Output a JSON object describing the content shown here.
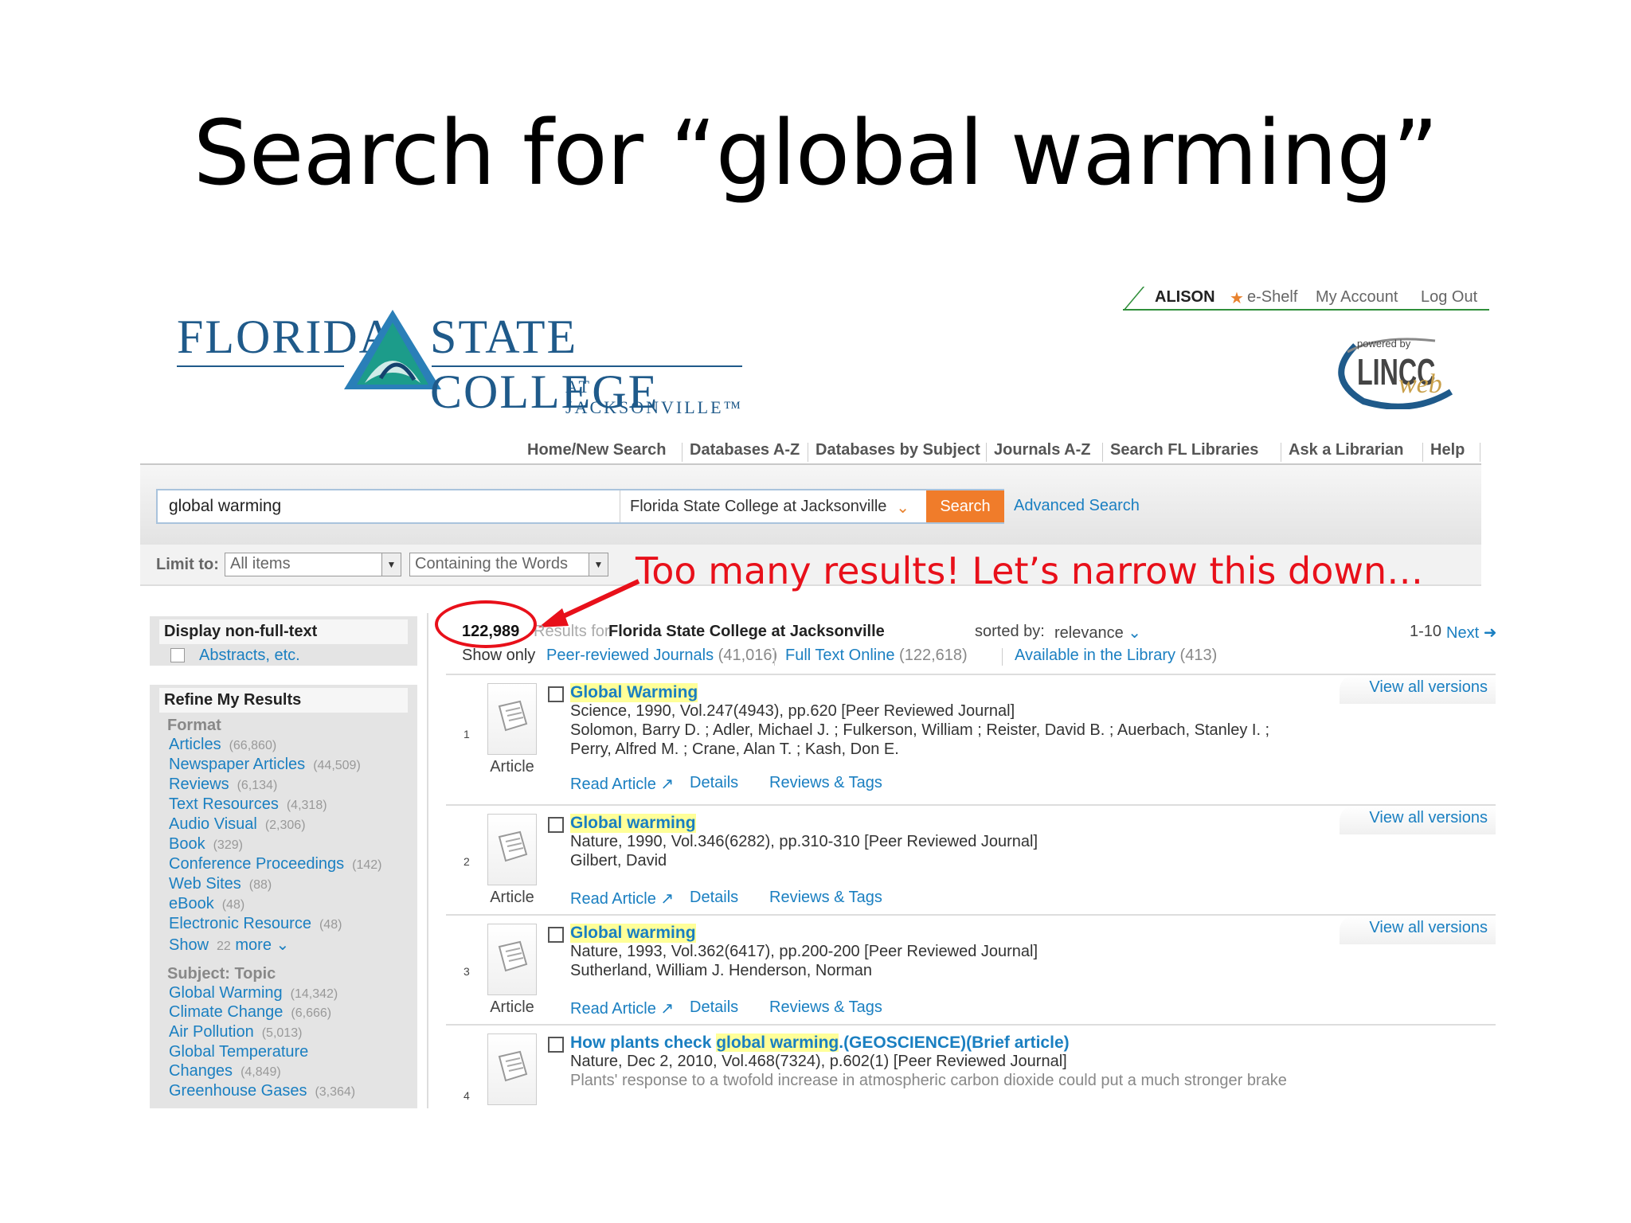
{
  "slide": {
    "title": "Search for “global warming”"
  },
  "annotation": "Too many results!  Let’s narrow this down…",
  "logo": {
    "word1": "FLORIDA",
    "word2": "STATE COLLEGE",
    "sub": "AT JACKSONVILLE™"
  },
  "userbar": {
    "user": "ALISON",
    "eshelf": "e-Shelf",
    "account": "My Account",
    "logout": "Log Out"
  },
  "lincc": {
    "powered": "powered by",
    "brand": "LINCC",
    "web": "web"
  },
  "nav": [
    "Home/New Search",
    "Databases A-Z",
    "Databases by Subject",
    "Journals A-Z",
    "Search FL Libraries",
    "Ask a Librarian",
    "Help"
  ],
  "search": {
    "query": "global warming",
    "scope": "Florida State College at Jacksonville",
    "button": "Search",
    "advanced": "Advanced Search"
  },
  "limit": {
    "label": "Limit to:",
    "items": "All items",
    "words": "Containing the Words"
  },
  "sidebar": {
    "display_head": "Display non-full-text",
    "display_opt": "Abstracts, etc.",
    "refine_head": "Refine My Results",
    "format_head": "Format",
    "formats": [
      {
        "label": "Articles",
        "count": "(66,860)"
      },
      {
        "label": "Newspaper Articles",
        "count": "(44,509)"
      },
      {
        "label": "Reviews",
        "count": "(6,134)"
      },
      {
        "label": "Text Resources",
        "count": "(4,318)"
      },
      {
        "label": "Audio Visual",
        "count": "(2,306)"
      },
      {
        "label": "Book",
        "count": "(329)"
      },
      {
        "label": "Conference Proceedings",
        "count": "(142)"
      },
      {
        "label": "Web Sites",
        "count": "(88)"
      },
      {
        "label": "eBook",
        "count": "(48)"
      },
      {
        "label": "Electronic Resource",
        "count": "(48)"
      }
    ],
    "show_more": {
      "show": "Show",
      "count": "22",
      "more": "more"
    },
    "subject_head": "Subject: Topic",
    "subjects": [
      {
        "label": "Global Warming",
        "count": "(14,342)"
      },
      {
        "label": "Climate Change",
        "count": "(6,666)"
      },
      {
        "label": "Air Pollution",
        "count": "(5,013)"
      },
      {
        "label": "Global Temperature",
        "count": ""
      },
      {
        "label": "Changes",
        "count": "(4,849)"
      },
      {
        "label": "Greenhouse Gases",
        "count": "(3,364)"
      }
    ]
  },
  "results": {
    "count": "122,989",
    "results_for": "Results for",
    "institution": "Florida State College at Jacksonville",
    "sorted_label": "sorted by:",
    "sorted_value": "relevance",
    "range": "1-10",
    "next": "Next",
    "show_only": "Show only",
    "filters": [
      {
        "label": "Peer-reviewed Journals",
        "count": "(41,016)"
      },
      {
        "label": "Full Text Online",
        "count": "(122,618)"
      },
      {
        "label": "Available in the Library",
        "count": "(413)"
      }
    ],
    "view_all": "View all versions",
    "type_label": "Article",
    "actions": {
      "read": "Read Article",
      "details": "Details",
      "reviews": "Reviews & Tags"
    },
    "items": [
      {
        "num": "1",
        "title": "Global Warming",
        "line1": "Science, 1990, Vol.247(4943), pp.620 [Peer Reviewed Journal]",
        "line2": "Solomon, Barry D. ; Adler, Michael J. ; Fulkerson, William ; Reister, David B. ; Auerbach, Stanley I. ;",
        "line3": "Perry, Alfred M. ; Crane, Alan T. ; Kash, Don E."
      },
      {
        "num": "2",
        "title": "Global warming",
        "line1": "Nature, 1990, Vol.346(6282), pp.310-310 [Peer Reviewed Journal]",
        "line2": "Gilbert, David"
      },
      {
        "num": "3",
        "title": "Global warming",
        "line1": "Nature, 1993, Vol.362(6417), pp.200-200 [Peer Reviewed Journal]",
        "line2": "Sutherland, William J. Henderson, Norman"
      },
      {
        "num": "4",
        "title_pre": "How plants check ",
        "title_hl": "global warming",
        "title_post": ".(GEOSCIENCE)(Brief article)",
        "line1": "Nature, Dec 2, 2010, Vol.468(7324), p.602(1) [Peer Reviewed Journal]",
        "line2": "Plants' response to a twofold increase in atmospheric carbon dioxide could put a much stronger brake"
      }
    ]
  },
  "colors": {
    "link": "#1a7fc1",
    "accent": "#f07c2a",
    "annotation": "#e8101a",
    "brand": "#1f5a8a"
  }
}
